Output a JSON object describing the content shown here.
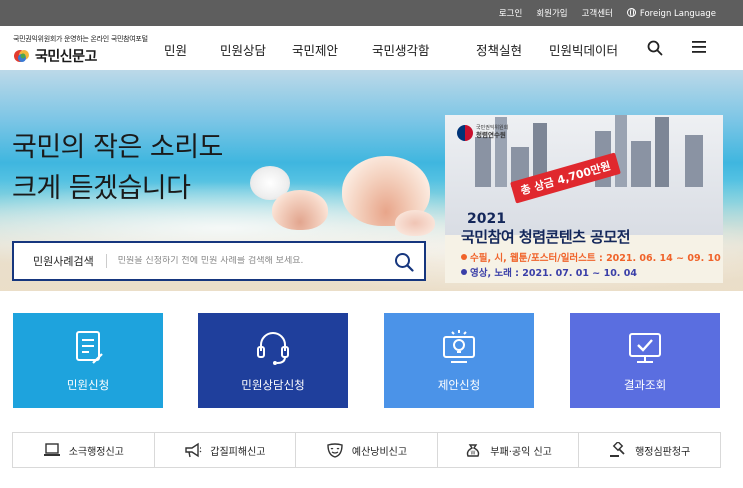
{
  "topbar": {
    "links": [
      "로그인",
      "회원가입",
      "고객센터",
      "Foreign Language"
    ]
  },
  "header": {
    "tagline": "국민권익위원회가 운영하는 온라인 국민참여포털",
    "logo_text": "국민신문고",
    "nav": [
      "민원",
      "민원상담",
      "국민제안",
      "국민생각함",
      "정책실현",
      "민원빅데이터"
    ]
  },
  "hero": {
    "headline_1": "국민의 작은 소리도",
    "headline_2": "크게 듣겠습니다",
    "search": {
      "label": "민원사례검색",
      "placeholder": "민원을 신청하기 전에 민원 사례를 검색해 보세요."
    }
  },
  "banner": {
    "org_small": "국민권익위원회",
    "org": "청렴연수원",
    "prize": "총 상금 4,700만원",
    "year": "2021",
    "title": "국민참여 청렴콘텐츠 공모전",
    "date_1": "수필, 시, 웹툰/포스터/일러스트 : 2021. 06. 14 ~ 09. 10",
    "date_2": "영상, 노래 : 2021. 07. 01 ~ 10. 04",
    "colors": {
      "orange": "#f0632a",
      "navy": "#14275a",
      "red": "#e0282e"
    }
  },
  "cards": [
    {
      "label": "민원신청",
      "color": "#1ea3dd",
      "icon": "document-pen-icon"
    },
    {
      "label": "민원상담신청",
      "color": "#1f3f9c",
      "icon": "headset-icon"
    },
    {
      "label": "제안신청",
      "color": "#4b93e8",
      "icon": "lightbulb-monitor-icon"
    },
    {
      "label": "결과조회",
      "color": "#5a6ee0",
      "icon": "monitor-check-icon"
    }
  ],
  "quick_links": [
    {
      "label": "소극행정신고",
      "icon": "laptop-icon"
    },
    {
      "label": "갑질피해신고",
      "icon": "megaphone-icon"
    },
    {
      "label": "예산낭비신고",
      "icon": "mask-icon"
    },
    {
      "label": "부패·공익 신고",
      "icon": "money-bag-icon"
    },
    {
      "label": "행정심판청구",
      "icon": "gavel-icon"
    }
  ]
}
